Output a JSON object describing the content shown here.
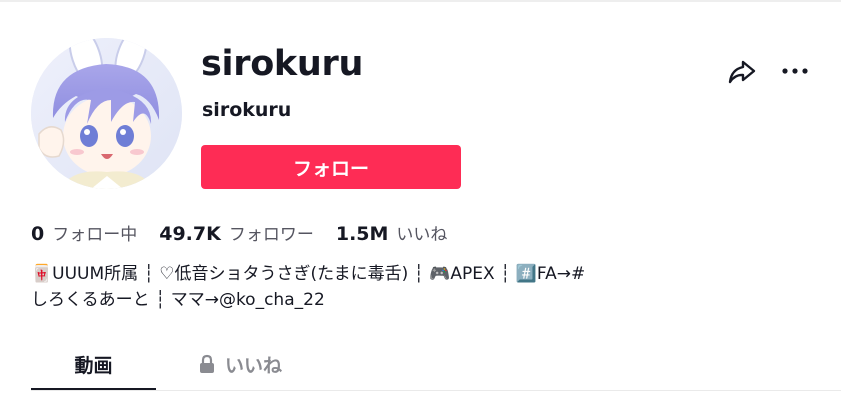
{
  "profile": {
    "username": "sirokuru",
    "nickname": "sirokuru",
    "follow_label": "フォロー"
  },
  "stats": {
    "following_count": "0",
    "following_label": "フォロー中",
    "followers_count": "49.7K",
    "followers_label": "フォロワー",
    "likes_count": "1.5M",
    "likes_label": "いいね"
  },
  "bio": {
    "text": "🀄UUUM所属 ┆ ♡低音ショタうさぎ(たまに毒舌) ┆ 🎮APEX ┆ #️⃣FA→#\nしろくるあーと ┆ ママ→@ko_cha_22"
  },
  "tabs": [
    {
      "label": "動画",
      "active": true
    },
    {
      "label": "いいね",
      "locked": true
    }
  ],
  "colors": {
    "follow_button": "#fe2c55",
    "text_primary": "#161823",
    "text_secondary": "#555560",
    "tab_inactive": "#8a8b91"
  },
  "icons": {
    "share": "share-arrow-icon",
    "more": "more-dots-icon",
    "lock": "lock-icon"
  }
}
